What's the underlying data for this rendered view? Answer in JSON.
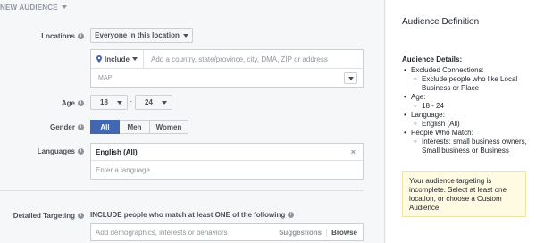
{
  "header": {
    "title": "NEW AUDIENCE"
  },
  "locations": {
    "label": "Locations",
    "dropdown": "Everyone in this location",
    "include": "Include",
    "search_placeholder": "Add a country, state/province, city, DMA, ZIP or address",
    "map_label": "MAP"
  },
  "age": {
    "label": "Age",
    "min": "18",
    "separator": "-",
    "max": "24"
  },
  "gender": {
    "label": "Gender",
    "options": [
      "All",
      "Men",
      "Women"
    ],
    "selected": "All"
  },
  "languages": {
    "label": "Languages",
    "selected": "English (All)",
    "remove": "×",
    "placeholder": "Enter a language..."
  },
  "targeting": {
    "label": "Detailed Targeting",
    "description": "INCLUDE people who match at least ONE of the following",
    "placeholder": "Add demographics, interests or behaviors",
    "suggestions": "Suggestions",
    "browse": "Browse"
  },
  "sidebar": {
    "title": "Audience Definition",
    "details_heading": "Audience Details:",
    "sections": [
      {
        "label": "Excluded Connections:",
        "items": [
          "Exclude people who like Local Business or Place"
        ]
      },
      {
        "label": "Age:",
        "items": [
          "18 - 24"
        ]
      },
      {
        "label": "Language:",
        "items": [
          "English (All)"
        ]
      },
      {
        "label": "People Who Match:",
        "items": [
          "Interests: small business owners, Small business or Business"
        ]
      }
    ],
    "warning": "Your audience targeting is incomplete. Select at least one location, or choose a Custom Audience."
  },
  "colors": {
    "accent": "#4267b2",
    "warning_bg": "#fffbe2"
  }
}
